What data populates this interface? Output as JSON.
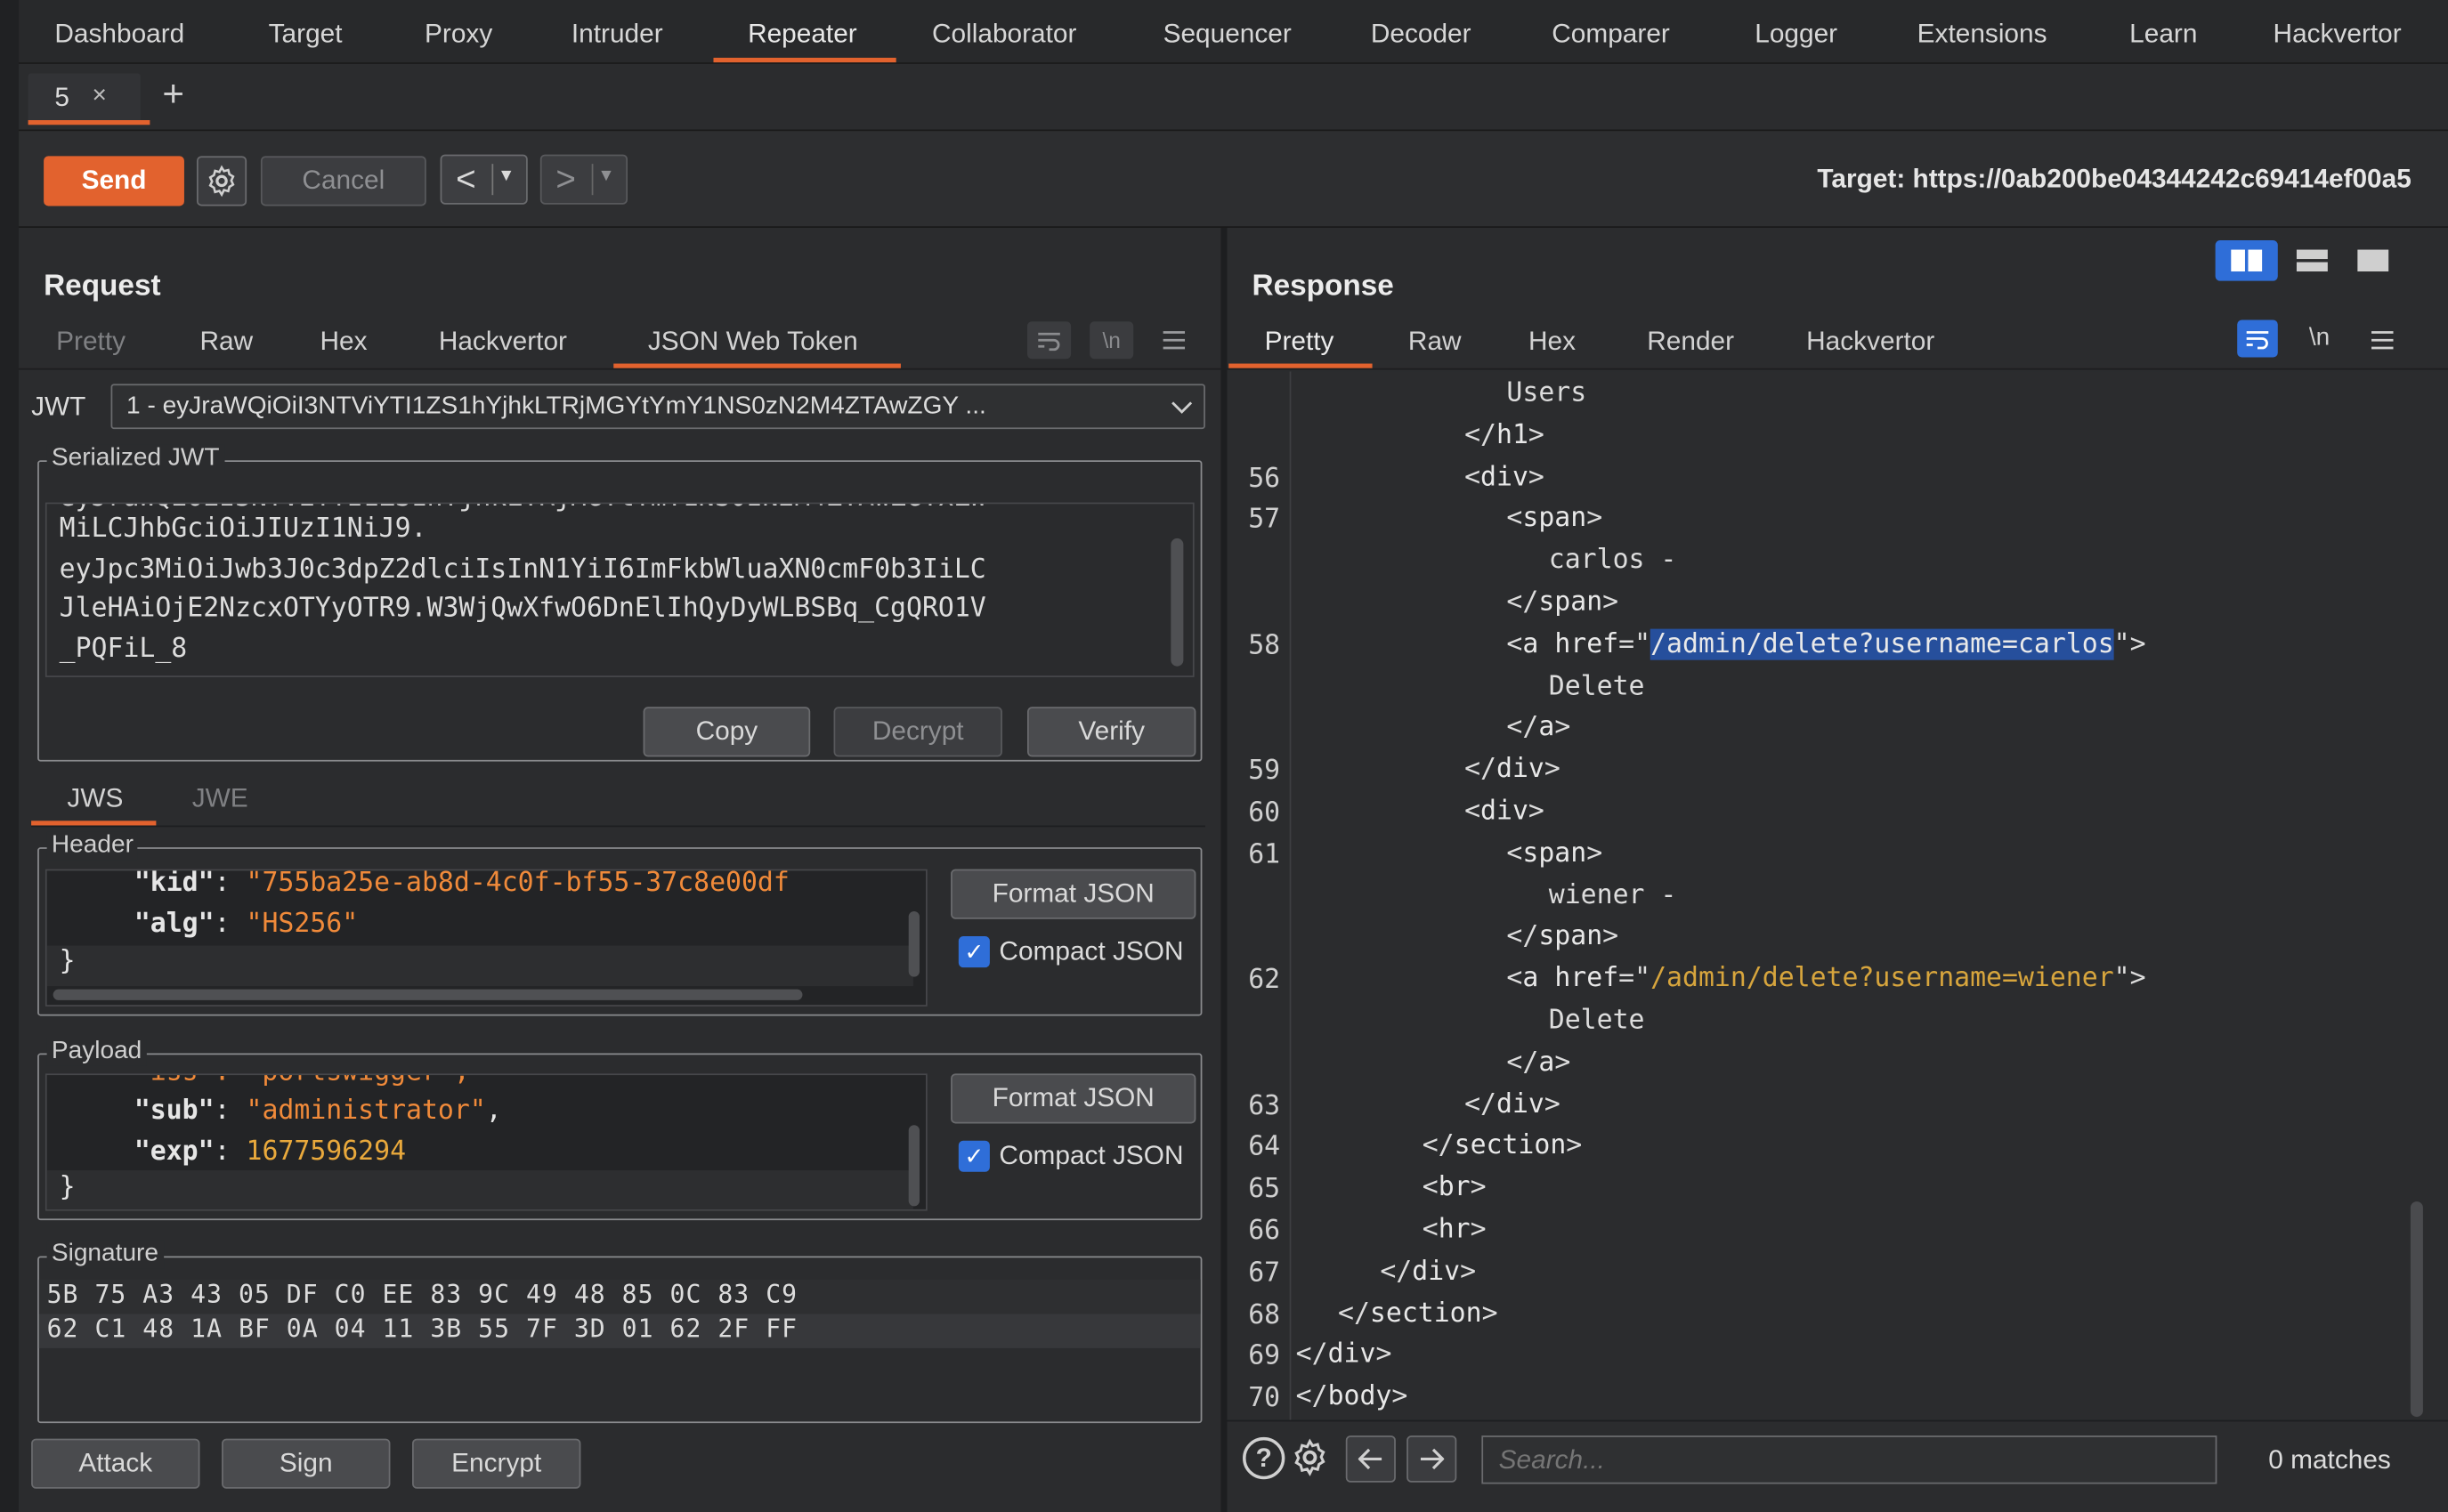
{
  "menu": {
    "tabs": [
      "Dashboard",
      "Target",
      "Proxy",
      "Intruder",
      "Repeater",
      "Collaborator",
      "Sequencer",
      "Decoder",
      "Comparer",
      "Logger",
      "Extensions",
      "Learn",
      "Hackvertor"
    ],
    "active_index": 4
  },
  "repeater_tabs": [
    {
      "label": "5",
      "close": "×"
    }
  ],
  "add_tab_symbol": "+",
  "toolbar": {
    "send_label": "Send",
    "cancel_label": "Cancel",
    "back_symbol": "<",
    "forward_symbol": ">",
    "dropdown_symbol": "▾",
    "target_text": "Target: https://0ab200be04344242c69414ef00a5"
  },
  "request": {
    "title": "Request",
    "tabs": [
      "Pretty",
      "Raw",
      "Hex",
      "Hackvertor",
      "JSON Web Token"
    ],
    "active_tab_index": 4,
    "disabled_tab_indexes": [
      0
    ],
    "jwt_label": "JWT",
    "jwt_selected": "1 - eyJraWQiOiI3NTViYTI1ZS1hYjhkLTRjMGYtYmY1NS0zN2M4ZTAwZGY ...",
    "serialized_legend": "Serialized JWT",
    "serialized_lines": [
      "MiLCJhbGciOiJIUzI1NiJ9.",
      "eyJpc3MiOiJwb3J0c3dpZ2dlciIsInN1YiI6ImFkbWluaXN0cmF0b3IiLC",
      "JleHAiOjE2NzcxOTYyOTR9.W3WjQwXfwO6DnElIhQyDyWLBSBq_CgQRO1V",
      "_PQFiL_8"
    ],
    "copy_label": "Copy",
    "decrypt_label": "Decrypt",
    "verify_label": "Verify",
    "jws_tab": "JWS",
    "jwe_tab": "JWE",
    "header_legend": "Header",
    "header_lines": [
      {
        "key": "\"kid\"",
        "sep": ": ",
        "value": "\"755ba25e-ab8d-4c0f-bf55-37c8e00df",
        "kind": "str"
      },
      {
        "key": "\"alg\"",
        "sep": ": ",
        "value": "\"HS256\"",
        "kind": "str"
      }
    ],
    "header_close": "}",
    "format_json_label": "Format JSON",
    "compact_json_label": "Compact JSON",
    "payload_legend": "Payload",
    "payload_partial_top": "\"iss\": \"portswigger\",",
    "payload_lines": [
      {
        "key": "\"sub\"",
        "sep": ": ",
        "value": "\"administrator\"",
        "tail": ",",
        "kind": "str"
      },
      {
        "key": "\"exp\"",
        "sep": ": ",
        "value": "1677596294",
        "tail": "",
        "kind": "num"
      }
    ],
    "payload_close": "}",
    "signature_legend": "Signature",
    "signature_rows": [
      "5B 75 A3 43 05 DF C0 EE 83 9C 49 48 85 0C 83 C9",
      "62 C1 48 1A BF 0A 04 11 3B 55 7F 3D 01 62 2F FF"
    ],
    "attack_label": "Attack",
    "sign_label": "Sign",
    "encrypt_label": "Encrypt"
  },
  "response": {
    "title": "Response",
    "tabs": [
      "Pretty",
      "Raw",
      "Hex",
      "Render",
      "Hackvertor"
    ],
    "active_tab_index": 0,
    "newline_symbol": "\\n",
    "code_lines": [
      {
        "n": "",
        "indent": 5,
        "parts": [
          [
            "text",
            "Users"
          ]
        ]
      },
      {
        "n": "",
        "indent": 4,
        "parts": [
          [
            "tag",
            "</"
          ],
          [
            "tagname",
            "h1"
          ],
          [
            "tag",
            ">"
          ]
        ]
      },
      {
        "n": "56",
        "indent": 4,
        "parts": [
          [
            "tag",
            "<"
          ],
          [
            "tagname",
            "div"
          ],
          [
            "tag",
            ">"
          ]
        ]
      },
      {
        "n": "57",
        "indent": 5,
        "parts": [
          [
            "tag",
            "<"
          ],
          [
            "tagname",
            "span"
          ],
          [
            "tag",
            ">"
          ]
        ]
      },
      {
        "n": "",
        "indent": 6,
        "parts": [
          [
            "text",
            "carlos -"
          ]
        ]
      },
      {
        "n": "",
        "indent": 5,
        "parts": [
          [
            "tag",
            "</"
          ],
          [
            "tagname",
            "span"
          ],
          [
            "tag",
            ">"
          ]
        ]
      },
      {
        "n": "58",
        "indent": 5,
        "parts": [
          [
            "tag",
            "<"
          ],
          [
            "tagname",
            "a"
          ],
          [
            "text",
            " "
          ],
          [
            "attr",
            "href"
          ],
          [
            "tag",
            "=\""
          ],
          [
            "sel",
            "/admin/delete?username=carlos"
          ],
          [
            "tag",
            "\">"
          ]
        ]
      },
      {
        "n": "",
        "indent": 6,
        "parts": [
          [
            "text",
            "Delete"
          ]
        ]
      },
      {
        "n": "",
        "indent": 5,
        "parts": [
          [
            "tag",
            "</"
          ],
          [
            "tagname",
            "a"
          ],
          [
            "tag",
            ">"
          ]
        ]
      },
      {
        "n": "59",
        "indent": 4,
        "parts": [
          [
            "tag",
            "</"
          ],
          [
            "tagname",
            "div"
          ],
          [
            "tag",
            ">"
          ]
        ]
      },
      {
        "n": "60",
        "indent": 4,
        "parts": [
          [
            "tag",
            "<"
          ],
          [
            "tagname",
            "div"
          ],
          [
            "tag",
            ">"
          ]
        ]
      },
      {
        "n": "61",
        "indent": 5,
        "parts": [
          [
            "tag",
            "<"
          ],
          [
            "tagname",
            "span"
          ],
          [
            "tag",
            ">"
          ]
        ]
      },
      {
        "n": "",
        "indent": 6,
        "parts": [
          [
            "text",
            "wiener -"
          ]
        ]
      },
      {
        "n": "",
        "indent": 5,
        "parts": [
          [
            "tag",
            "</"
          ],
          [
            "tagname",
            "span"
          ],
          [
            "tag",
            ">"
          ]
        ]
      },
      {
        "n": "62",
        "indent": 5,
        "parts": [
          [
            "tag",
            "<"
          ],
          [
            "tagname",
            "a"
          ],
          [
            "text",
            " "
          ],
          [
            "attr",
            "href"
          ],
          [
            "tag",
            "=\""
          ],
          [
            "aval",
            "/admin/delete?username=wiener"
          ],
          [
            "tag",
            "\">"
          ]
        ]
      },
      {
        "n": "",
        "indent": 6,
        "parts": [
          [
            "text",
            "Delete"
          ]
        ]
      },
      {
        "n": "",
        "indent": 5,
        "parts": [
          [
            "tag",
            "</"
          ],
          [
            "tagname",
            "a"
          ],
          [
            "tag",
            ">"
          ]
        ]
      },
      {
        "n": "63",
        "indent": 4,
        "parts": [
          [
            "tag",
            "</"
          ],
          [
            "tagname",
            "div"
          ],
          [
            "tag",
            ">"
          ]
        ]
      },
      {
        "n": "64",
        "indent": 3,
        "parts": [
          [
            "tag",
            "</"
          ],
          [
            "tagname",
            "section"
          ],
          [
            "tag",
            ">"
          ]
        ]
      },
      {
        "n": "65",
        "indent": 3,
        "parts": [
          [
            "tag",
            "<"
          ],
          [
            "tagname",
            "br"
          ],
          [
            "tag",
            ">"
          ]
        ]
      },
      {
        "n": "66",
        "indent": 3,
        "parts": [
          [
            "tag",
            "<"
          ],
          [
            "tagname",
            "hr"
          ],
          [
            "tag",
            ">"
          ]
        ]
      },
      {
        "n": "67",
        "indent": 2,
        "parts": [
          [
            "tag",
            "</"
          ],
          [
            "tagname",
            "div"
          ],
          [
            "tag",
            ">"
          ]
        ]
      },
      {
        "n": "68",
        "indent": 1,
        "parts": [
          [
            "tag",
            "</"
          ],
          [
            "tagname",
            "section"
          ],
          [
            "tag",
            ">"
          ]
        ]
      },
      {
        "n": "69",
        "indent": 0,
        "parts": [
          [
            "tag",
            "</"
          ],
          [
            "tagname",
            "div"
          ],
          [
            "tag",
            ">"
          ]
        ]
      },
      {
        "n": "70",
        "indent": 0,
        "parts": [
          [
            "tag",
            "</"
          ],
          [
            "tagname",
            "body"
          ],
          [
            "tag",
            ">"
          ]
        ]
      }
    ],
    "search_placeholder": "Search...",
    "matches_text": "0 matches"
  },
  "colors": {
    "accent": "#e2622e",
    "selection": "#264f9c",
    "checkbox": "#2f6ed8"
  }
}
